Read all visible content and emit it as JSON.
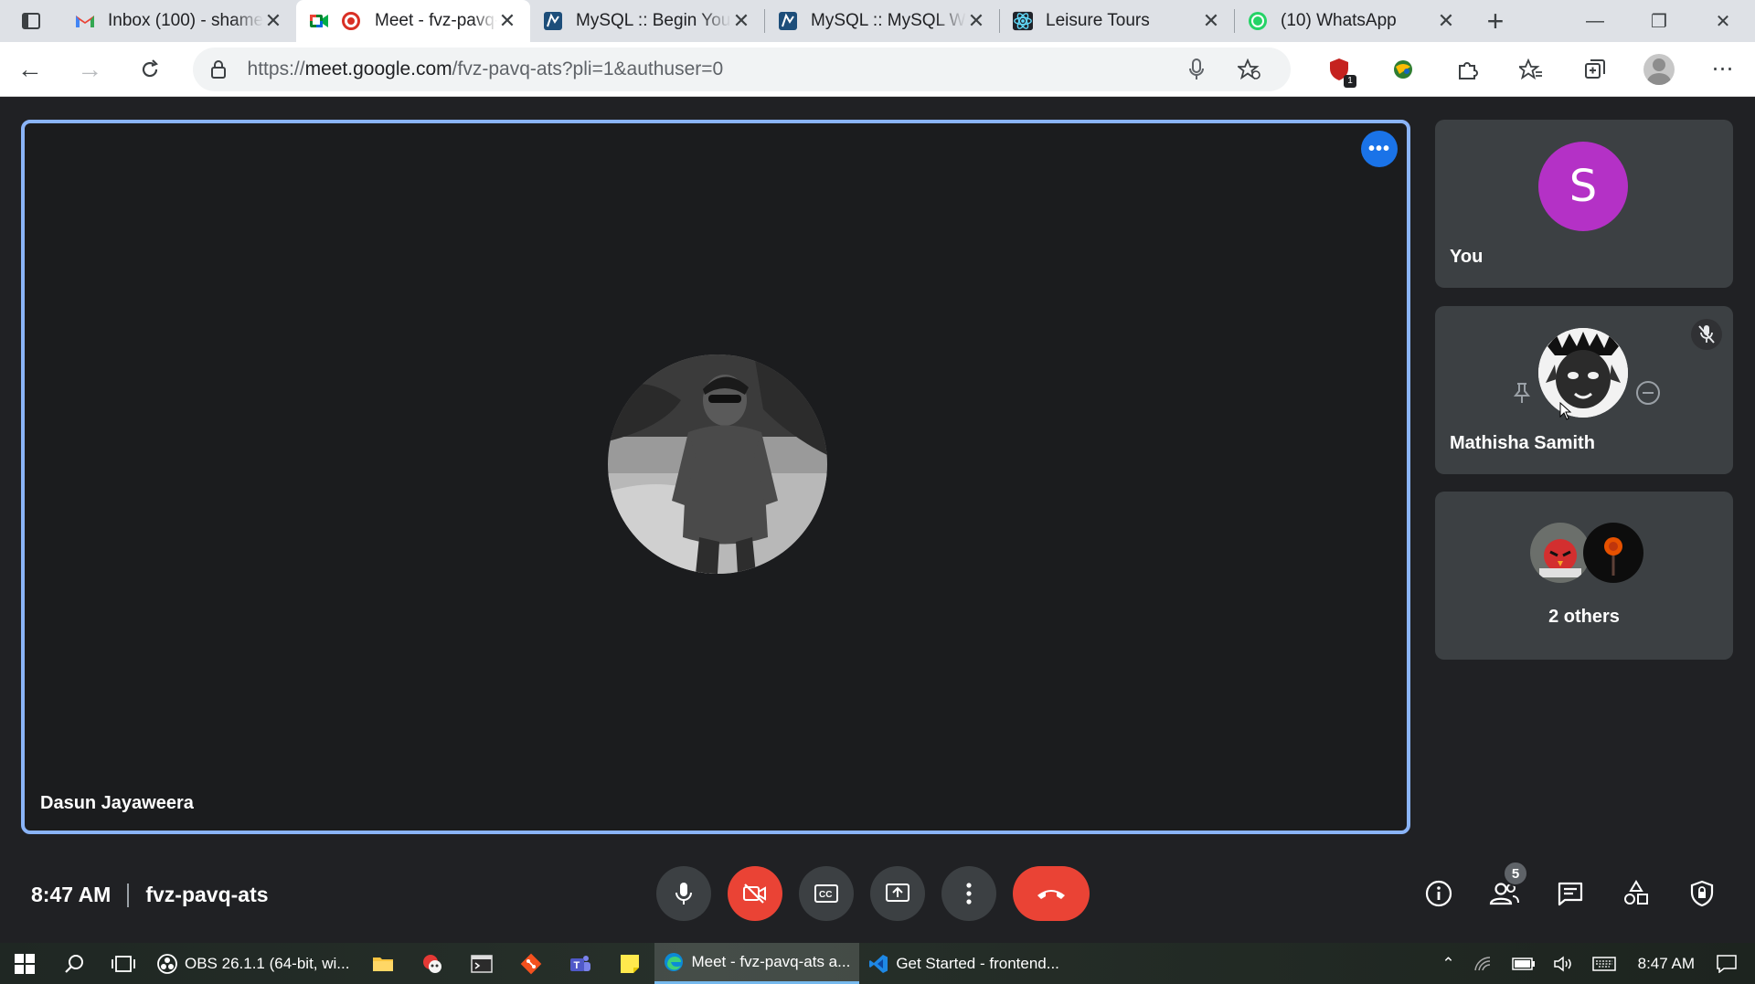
{
  "browser": {
    "tabs": [
      {
        "title": "Inbox (100) - shame",
        "icon": "gmail-icon",
        "active": false
      },
      {
        "title": "Meet - fvz-pavq-ats",
        "icon": "google-meet-icon",
        "active": true,
        "recording": true
      },
      {
        "title": "MySQL :: Begin Your",
        "icon": "mysql-icon",
        "active": false
      },
      {
        "title": "MySQL :: MySQL Wo",
        "icon": "mysql-icon",
        "active": false
      },
      {
        "title": "Leisure Tours",
        "icon": "react-icon",
        "active": false
      },
      {
        "title": "(10) WhatsApp",
        "icon": "whatsapp-icon",
        "active": false
      }
    ],
    "url_prefix": "https://",
    "url_host": "meet.google.com",
    "url_path": "/fvz-pavq-ats?pli=1&authuser=0",
    "extension_badge": "1"
  },
  "meet": {
    "main_participant": {
      "name": "Dasun Jayaweera"
    },
    "side_tiles": [
      {
        "name": "You",
        "initial": "S",
        "color": "#b431c6"
      },
      {
        "name": "Mathisha Samith",
        "muted": true
      },
      {
        "label": "2 others"
      }
    ],
    "clock": "8:47 AM",
    "meeting_code": "fvz-pavq-ats",
    "participant_count": "5"
  },
  "taskbar": {
    "apps": [
      {
        "label": "OBS 26.1.1 (64-bit, wi...",
        "icon": "obs-icon",
        "active": false
      },
      {
        "label": "Meet - fvz-pavq-ats a...",
        "icon": "edge-icon",
        "active": true
      },
      {
        "label": "Get Started - frontend...",
        "icon": "vscode-icon",
        "active": false
      }
    ],
    "time": "8:47 AM"
  },
  "colors": {
    "accent_blue": "#8ab4f8",
    "end_call_red": "#ea4335",
    "avatar_purple": "#b431c6"
  }
}
